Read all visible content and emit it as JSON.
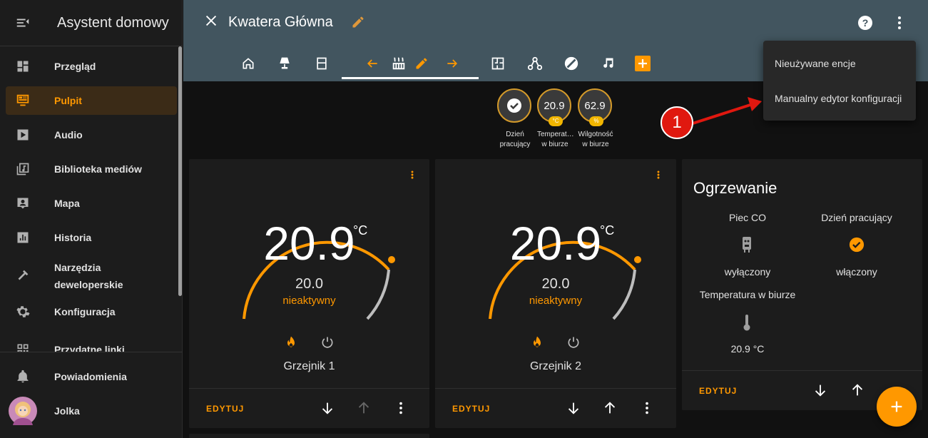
{
  "sidebar": {
    "title": "Asystent domowy",
    "items": [
      {
        "label": "Przegląd",
        "icon": "dashboard-icon"
      },
      {
        "label": "Pulpit",
        "icon": "monitor-dashboard-icon",
        "active": true
      },
      {
        "label": "Audio",
        "icon": "play-box-icon"
      },
      {
        "label": "Biblioteka mediów",
        "icon": "music-library-icon"
      },
      {
        "label": "Mapa",
        "icon": "account-box-icon"
      },
      {
        "label": "Historia",
        "icon": "chart-box-icon"
      },
      {
        "label": "Narzędzia deweloperskie",
        "icon": "hammer-icon"
      },
      {
        "label": "Konfiguracja",
        "icon": "gear-icon"
      },
      {
        "label": "Przydatne linki",
        "icon": "qr-icon"
      }
    ],
    "notifications": "Powiadomienia",
    "user": "Jolka"
  },
  "header": {
    "title": "Kwatera Główna",
    "tabs": [
      "home-icon",
      "lamp-icon",
      "door-icon",
      "arrow-left-icon",
      "radiator-icon",
      "pencil-icon",
      "arrow-right-icon",
      "floor-plan-icon",
      "graph-icon",
      "disc-icon",
      "music-icon",
      "add-icon"
    ]
  },
  "menu": {
    "items": [
      "Nieużywane encje",
      "Manualny edytor konfiguracji"
    ]
  },
  "annotation": "1",
  "badges": [
    {
      "value": "",
      "unit": "",
      "name": "Dzień pracujący"
    },
    {
      "value": "20.9",
      "unit": "°C",
      "name": "Temperat… w biurze"
    },
    {
      "value": "62.9",
      "unit": "%",
      "name": "Wilgotność w biurze"
    }
  ],
  "thermostats": [
    {
      "current": "20.9",
      "unit": "°C",
      "target": "20.0",
      "state": "nieaktywny",
      "name": "Grzejnik 1",
      "edit": "EDYTUJ"
    },
    {
      "current": "20.9",
      "unit": "°C",
      "target": "20.0",
      "state": "nieaktywny",
      "name": "Grzejnik 2",
      "edit": "EDYTUJ"
    }
  ],
  "entities_card": {
    "title": "Ogrzewanie",
    "items": [
      {
        "name": "Piec CO",
        "state": "wyłączony"
      },
      {
        "name": "Dzień pracujący",
        "state": "włączony"
      },
      {
        "name": "Temperatura w biurze",
        "state": "20.9 °C"
      }
    ],
    "edit": "EDYTUJ"
  },
  "colors": {
    "accent": "#ff9800",
    "header": "#42555f",
    "annotation": "#e0180f"
  }
}
